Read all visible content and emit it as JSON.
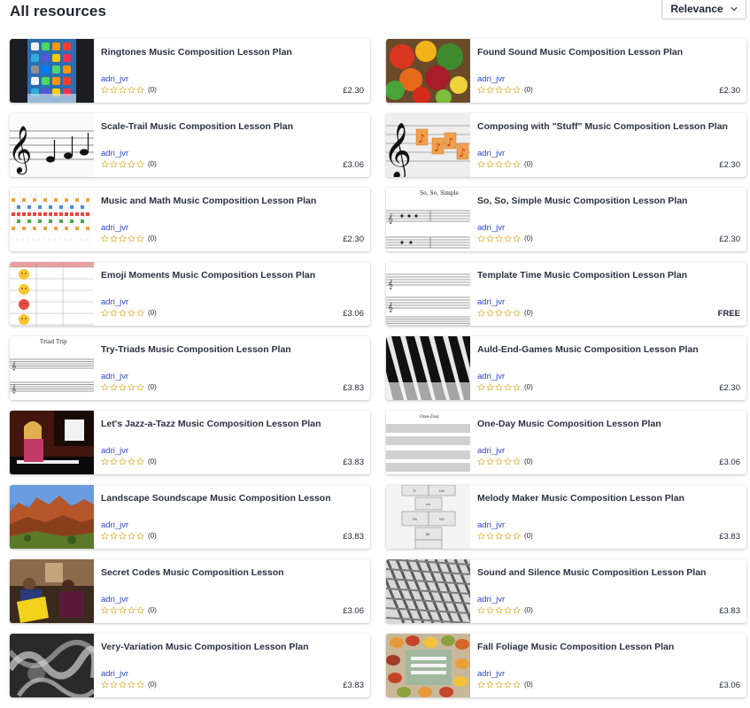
{
  "header": {
    "title": "All resources",
    "sort_label": "Relevance"
  },
  "cards": [
    {
      "title": "Ringtones Music Composition Lesson Plan",
      "author": "adri_jvr",
      "rating_count": "(0)",
      "price": "£2.30",
      "thumb": "phone",
      "stars": 0
    },
    {
      "title": "Found Sound Music Composition Lesson Plan",
      "author": "adri_jvr",
      "rating_count": "(0)",
      "price": "£2.30",
      "thumb": "veggies",
      "stars": 0
    },
    {
      "title": "Scale-Trail Music Composition Lesson Plan",
      "author": "adri_jvr",
      "rating_count": "(0)",
      "price": "£3.06",
      "thumb": "staff",
      "stars": 0
    },
    {
      "title": "Composing with \"Stuff\" Music Composition Lesson Plan",
      "author": "adri_jvr",
      "rating_count": "(0)",
      "price": "£2.30",
      "thumb": "notes",
      "stars": 0
    },
    {
      "title": "Music and Math Music Composition Lesson Plan",
      "author": "adri_jvr",
      "rating_count": "(0)",
      "price": "£2.30",
      "thumb": "grid",
      "stars": 0
    },
    {
      "title": "So, So, Simple Music Composition Lesson Plan",
      "author": "adri_jvr",
      "rating_count": "(0)",
      "price": "£2.30",
      "thumb": "sheet",
      "stars": 0,
      "thumb_text": "So, So, Simple"
    },
    {
      "title": "Emoji Moments Music Composition Lesson Plan",
      "author": "adri_jvr",
      "rating_count": "(0)",
      "price": "£3.06",
      "thumb": "emoji",
      "stars": 0
    },
    {
      "title": "Template Time Music Composition Lesson Plan",
      "author": "adri_jvr",
      "rating_count": "(0)",
      "price": "FREE",
      "thumb": "template",
      "stars": 0
    },
    {
      "title": "Try-Triads Music Composition Lesson Plan",
      "author": "adri_jvr",
      "rating_count": "(0)",
      "price": "£3.83",
      "thumb": "triad",
      "stars": 0,
      "thumb_text": "Triad Trip"
    },
    {
      "title": "Auld-End-Games Music Composition Lesson Plan",
      "author": "adri_jvr",
      "rating_count": "(0)",
      "price": "£2.30",
      "thumb": "piano",
      "stars": 0
    },
    {
      "title": "Let's Jazz-a-Tazz Music Composition Lesson Plan",
      "author": "adri_jvr",
      "rating_count": "(0)",
      "price": "£3.83",
      "thumb": "girlpiano",
      "stars": 0
    },
    {
      "title": "One-Day Music Composition Lesson Plan",
      "author": "adri_jvr",
      "rating_count": "(0)",
      "price": "£3.06",
      "thumb": "score",
      "stars": 0,
      "thumb_text": "One-Day"
    },
    {
      "title": "Landscape Soundscape Music Composition Lesson",
      "author": "adri_jvr",
      "rating_count": "(0)",
      "price": "£3.83",
      "thumb": "canyon",
      "stars": 0
    },
    {
      "title": "Melody Maker Music Composition Lesson Plan",
      "author": "adri_jvr",
      "rating_count": "(0)",
      "price": "£3.83",
      "thumb": "hopscotch",
      "stars": 0
    },
    {
      "title": "Secret Codes Music Composition Lesson",
      "author": "adri_jvr",
      "rating_count": "(0)",
      "price": "£3.06",
      "thumb": "class",
      "stars": 0
    },
    {
      "title": "Sound and Silence Music Composition Lesson Plan",
      "author": "adri_jvr",
      "rating_count": "(0)",
      "price": "£3.83",
      "thumb": "pergola",
      "stars": 0
    },
    {
      "title": "Very-Variation Music Composition Lesson Plan",
      "author": "adri_jvr",
      "rating_count": "(0)",
      "price": "£3.83",
      "thumb": "smoke",
      "stars": 0
    },
    {
      "title": "Fall Foliage Music Composition Lesson Plan",
      "author": "adri_jvr",
      "rating_count": "(0)",
      "price": "£3.06",
      "thumb": "foliage",
      "stars": 0
    }
  ],
  "colors": {
    "accent_link": "#2c44c8",
    "star": "#e2b33c",
    "text": "#1f2533"
  }
}
